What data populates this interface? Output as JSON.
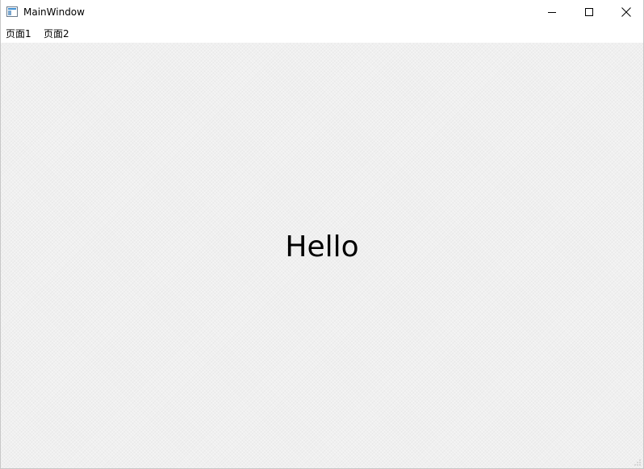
{
  "window": {
    "title": "MainWindow",
    "icon": "app-window-icon",
    "controls": [
      "minimize-icon",
      "maximize-icon",
      "close-icon"
    ]
  },
  "menubar": {
    "items": [
      {
        "label": "页面1"
      },
      {
        "label": "页面2"
      }
    ]
  },
  "content": {
    "label": "Hello"
  }
}
